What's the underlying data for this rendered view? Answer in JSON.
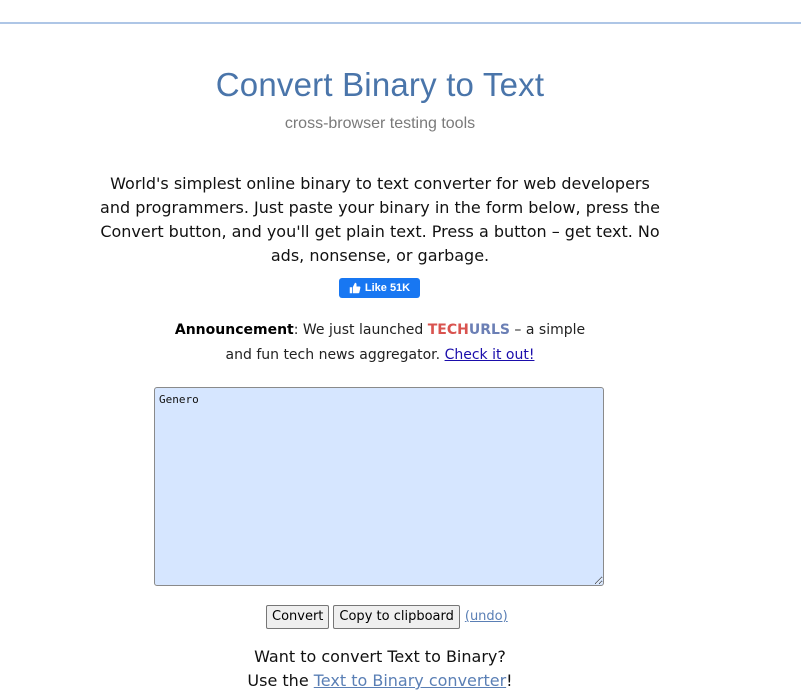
{
  "header": {
    "title": "Convert Binary to Text",
    "subtitle": "cross-browser testing tools"
  },
  "intro": {
    "text": "World's simplest online binary to text converter for web developers and programmers. Just paste your binary in the form below, press the Convert button, and you'll get plain text. Press a button – get text. No ads, nonsense, or garbage."
  },
  "like": {
    "label": "Like 51K",
    "color": "#1877f2",
    "icon": "thumbs-up-icon"
  },
  "announcement": {
    "label": "Announcement",
    "text_before": ": We just launched ",
    "brand_part1": "TECH",
    "brand_part2": "URLS",
    "text_after": " – a simple and fun tech news aggregator. ",
    "link": "Check it out!"
  },
  "editor": {
    "value": "Genero",
    "background": "#d6e6ff"
  },
  "actions": {
    "convert_label": "Convert",
    "copy_label": "Copy to clipboard",
    "undo_label": "(undo)"
  },
  "footer": {
    "line1": "Want to convert Text to Binary?",
    "line2_before": "Use the ",
    "line2_link": "Text to Binary converter",
    "line2_after": "!"
  },
  "colors": {
    "title": "#4a75aa",
    "top_rule": "#aec6e6",
    "tech": "#d9534f",
    "urls": "#6b7fb5"
  }
}
